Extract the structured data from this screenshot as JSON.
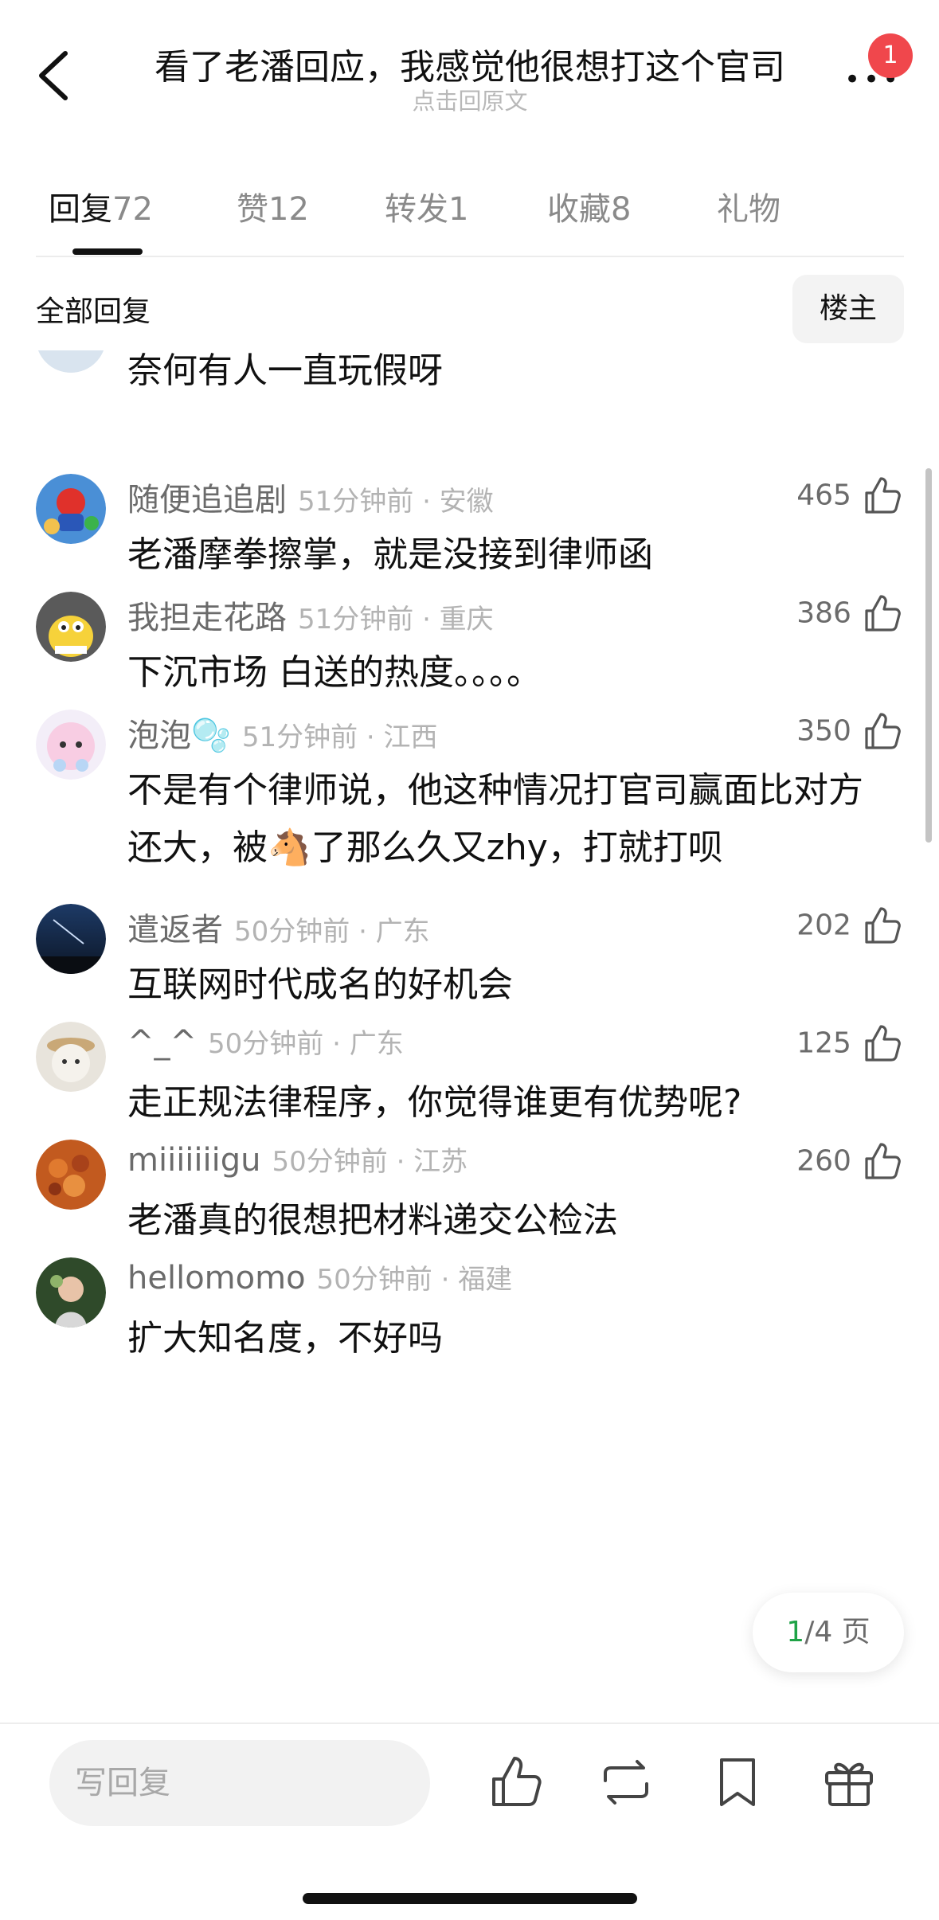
{
  "header": {
    "title": "看了老潘回应，我感觉他很想打这个官司",
    "subtitle": "点击回原文",
    "notification_count": "1"
  },
  "tabs": [
    {
      "label": "回复",
      "count": "72"
    },
    {
      "label": "赞",
      "count": "12"
    },
    {
      "label": "转发",
      "count": "1"
    },
    {
      "label": "收藏",
      "count": "8"
    },
    {
      "label": "礼物",
      "count": ""
    }
  ],
  "section": {
    "title": "全部回复",
    "owner_button": "楼主"
  },
  "partial_comment": {
    "text": "奈何有人一直玩假呀"
  },
  "comments": [
    {
      "name": "随便追追剧",
      "meta": "51分钟前 · 安徽",
      "likes": "465",
      "text": "老潘摩拳擦掌，就是没接到律师函"
    },
    {
      "name": "我担走花路",
      "meta": "51分钟前 · 重庆",
      "likes": "386",
      "text": "下沉市场 白送的热度。。。。"
    },
    {
      "name": "泡泡🫧",
      "meta": "51分钟前 · 江西",
      "likes": "350",
      "text": "不是有个律师说，他这种情况打官司赢面比对方还大，被🐴了那么久又zhy，打就打呗"
    },
    {
      "name": "遣返者",
      "meta": "50分钟前 · 广东",
      "likes": "202",
      "text": "互联网时代成名的好机会"
    },
    {
      "name": "^_^",
      "meta": "50分钟前 · 广东",
      "likes": "125",
      "text": "走正规法律程序，你觉得谁更有优势呢?"
    },
    {
      "name": "miiiiiiigu",
      "meta": "50分钟前 · 江苏",
      "likes": "260",
      "text": "老潘真的很想把材料递交公检法"
    },
    {
      "name": "hellomomo",
      "meta": "50分钟前 · 福建",
      "likes": "",
      "text": "扩大知名度，不好吗"
    }
  ],
  "pagination": {
    "current": "1",
    "rest": "/4 页"
  },
  "bottom_bar": {
    "reply_placeholder": "写回复"
  },
  "colors": {
    "accent_green": "#1fa347",
    "badge_red": "#f0474c"
  }
}
